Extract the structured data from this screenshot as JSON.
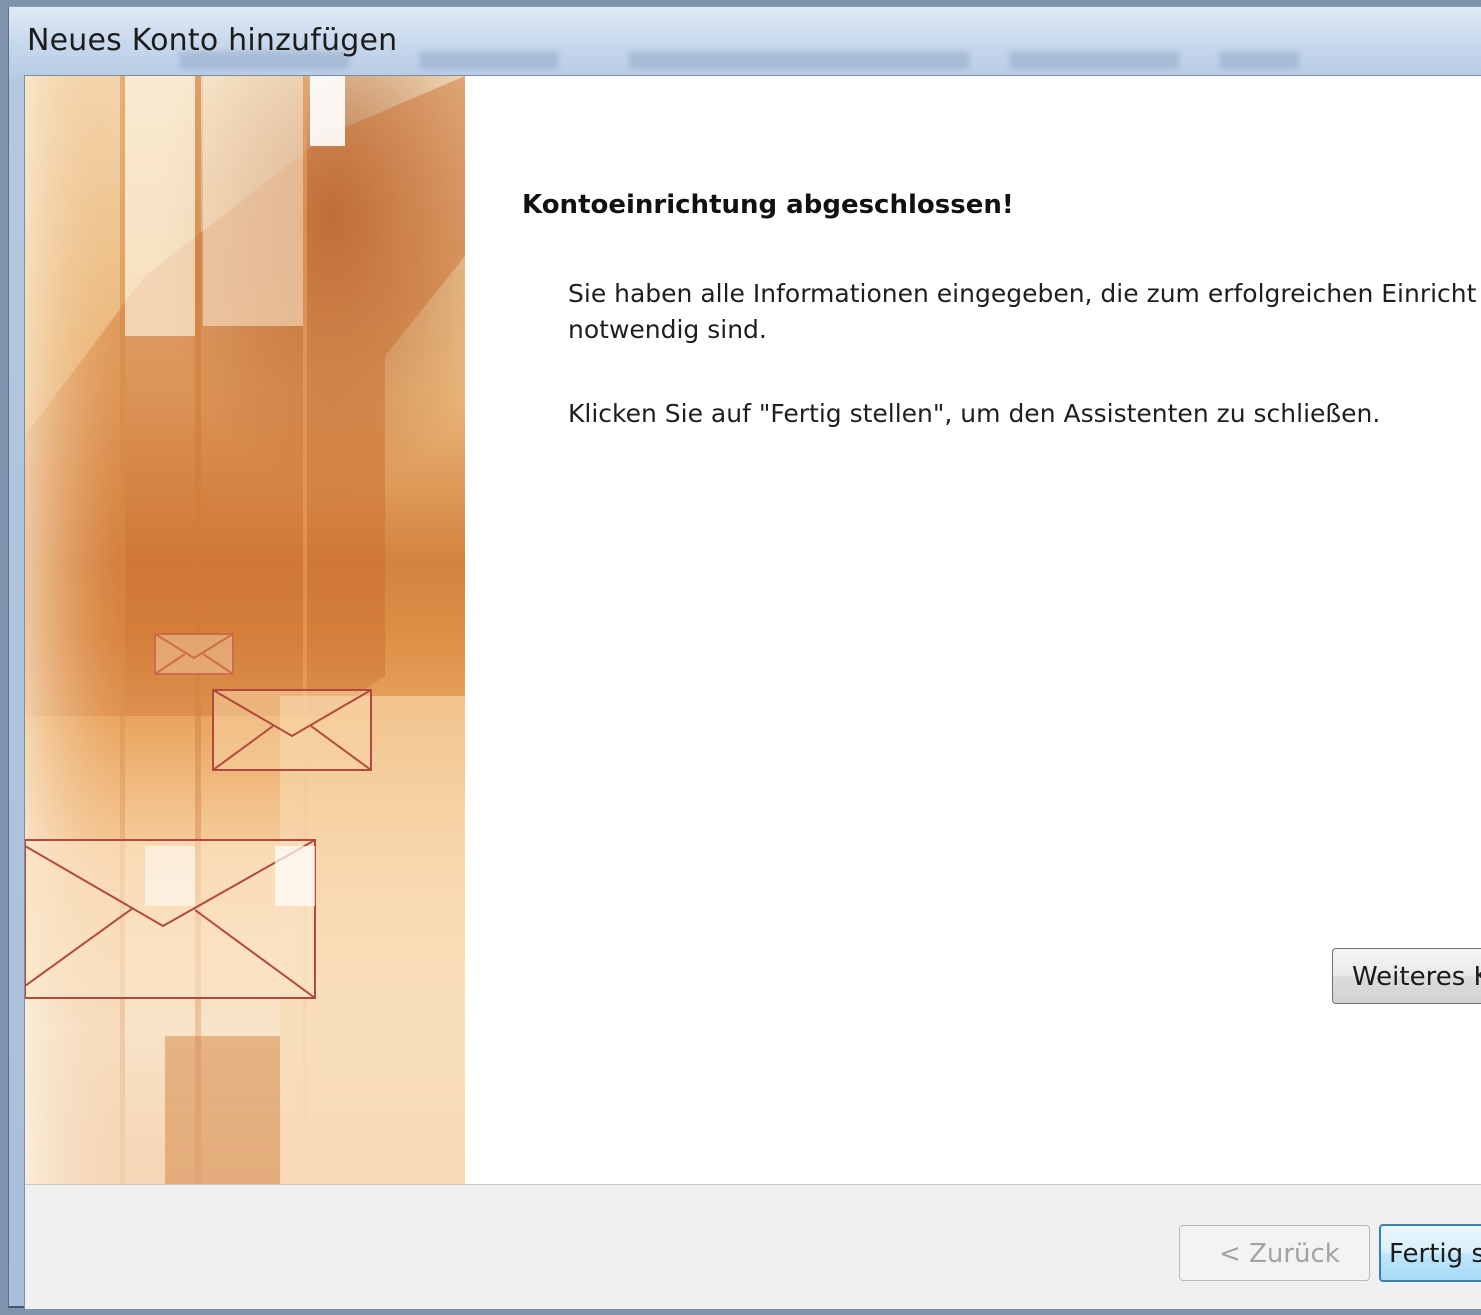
{
  "window": {
    "title": "Neues Konto hinzufügen"
  },
  "main": {
    "heading": "Kontoeinrichtung abgeschlossen!",
    "paragraph1_line1": "Sie haben alle Informationen eingegeben, die zum erfolgreichen Einricht",
    "paragraph1_line2": "notwendig sind.",
    "paragraph2": "Klicken Sie auf \"Fertig stellen\", um den Assistenten zu schließen.",
    "add_account_button": "Weiteres K"
  },
  "footer": {
    "back_button": "< Zurück",
    "finish_button": "Fertig s"
  },
  "colors": {
    "art_orange": "#e08a3c",
    "envelope_stroke": "#b5483c",
    "finish_button_border": "#3c7fb1"
  }
}
